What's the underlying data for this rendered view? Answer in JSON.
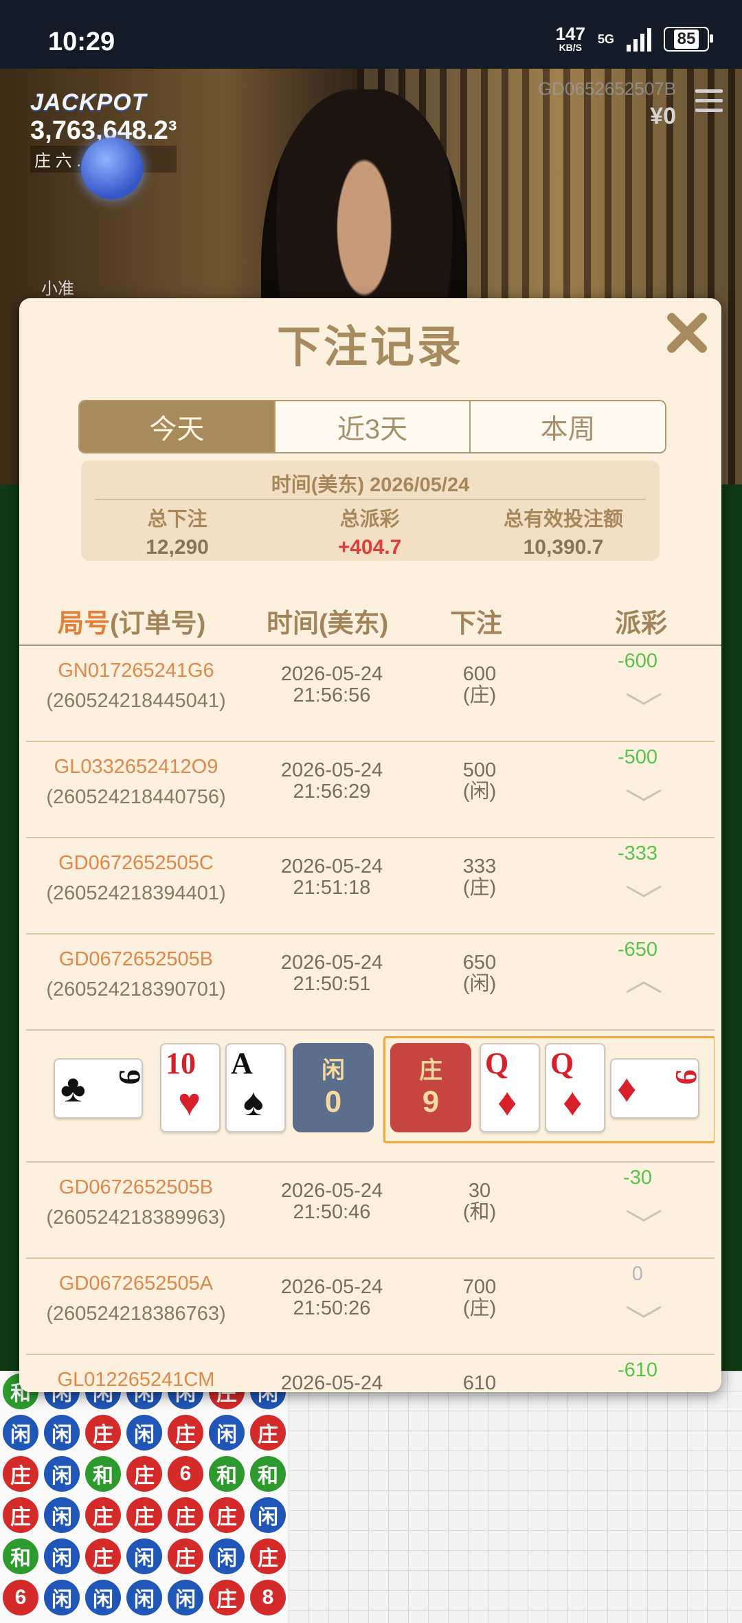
{
  "status": {
    "time": "10:29",
    "speed": "147",
    "speed_unit": "KB/S",
    "network": "5G",
    "battery": "85"
  },
  "game": {
    "jackpot_label": "JACKPOT",
    "jackpot_amount": "3,763,648.2³",
    "jackpot_sub": "庄 六 ... 时",
    "table_id": "GD0652652507B",
    "balance": "¥0",
    "under_label": "小准"
  },
  "modal": {
    "title": "下注记录",
    "tabs": [
      {
        "label": "今天",
        "active": true
      },
      {
        "label": "近3天",
        "active": false
      },
      {
        "label": "本周",
        "active": false
      }
    ],
    "summary": {
      "date": "时间(美东) 2026/05/24",
      "total_bet_label": "总下注",
      "total_bet": "12,290",
      "total_payout_label": "总派彩",
      "total_payout": "+404.7",
      "valid_bet_label": "总有效投注额",
      "valid_bet": "10,390.7"
    },
    "headers": {
      "id_a": "局号",
      "id_b": "(订单号)",
      "time": "时间(美东)",
      "bet": "下注",
      "payout": "派彩"
    },
    "rows": [
      {
        "game_id": "GN017265241G6",
        "order": "(260524218445041)",
        "date": "2026-05-24",
        "time": "21:56:56",
        "bet": "600",
        "side": "(庄)",
        "payout": "-600",
        "expanded": false
      },
      {
        "game_id": "GL0332652412O9",
        "order": "(260524218440756)",
        "date": "2026-05-24",
        "time": "21:56:29",
        "bet": "500",
        "side": "(闲)",
        "payout": "-500",
        "expanded": false
      },
      {
        "game_id": "GD0672652505C",
        "order": "(260524218394401)",
        "date": "2026-05-24",
        "time": "21:51:18",
        "bet": "333",
        "side": "(庄)",
        "payout": "-333",
        "expanded": false
      },
      {
        "game_id": "GD0672652505B",
        "order": "(260524218390701)",
        "date": "2026-05-24",
        "time": "21:50:51",
        "bet": "650",
        "side": "(闲)",
        "payout": "-650",
        "expanded": true
      },
      {
        "game_id": "GD0672652505B",
        "order": "(260524218389963)",
        "date": "2026-05-24",
        "time": "21:50:46",
        "bet": "30",
        "side": "(和)",
        "payout": "-30",
        "expanded": false
      },
      {
        "game_id": "GD0672652505A",
        "order": "(260524218386763)",
        "date": "2026-05-24",
        "time": "21:50:26",
        "bet": "700",
        "side": "(庄)",
        "payout": "0",
        "expanded": false
      },
      {
        "game_id": "GL012265241CM",
        "order": "",
        "date": "2026-05-24",
        "time": "",
        "bet": "610",
        "side": "",
        "payout": "-610",
        "expanded": false
      }
    ],
    "hand": {
      "player_label": "闲",
      "player_score": "0",
      "banker_label": "庄",
      "banker_score": "9",
      "player_cards": [
        {
          "rank": "9",
          "suit": "♣",
          "color": "black"
        },
        {
          "rank": "10",
          "suit": "♥",
          "color": "red"
        },
        {
          "rank": "A",
          "suit": "♠",
          "color": "black"
        }
      ],
      "banker_cards": [
        {
          "rank": "Q",
          "suit": "♦",
          "color": "red"
        },
        {
          "rank": "Q",
          "suit": "♦",
          "color": "red"
        },
        {
          "rank": "9",
          "suit": "♦",
          "color": "red"
        }
      ]
    }
  },
  "bead_road": [
    "和",
    "闲",
    "闲",
    "闲",
    "闲",
    "庄",
    "闲",
    "闲",
    "闲",
    "庄",
    "闲",
    "庄",
    "闲",
    "庄",
    "庄",
    "闲",
    "和",
    "庄",
    "6",
    "和",
    "和",
    "庄",
    "闲",
    "庄",
    "庄",
    "庄",
    "庄",
    "闲",
    "和",
    "闲",
    "庄",
    "闲",
    "庄",
    "闲",
    "庄",
    "6",
    "闲",
    "闲",
    "闲",
    "闲",
    "庄",
    "8"
  ]
}
